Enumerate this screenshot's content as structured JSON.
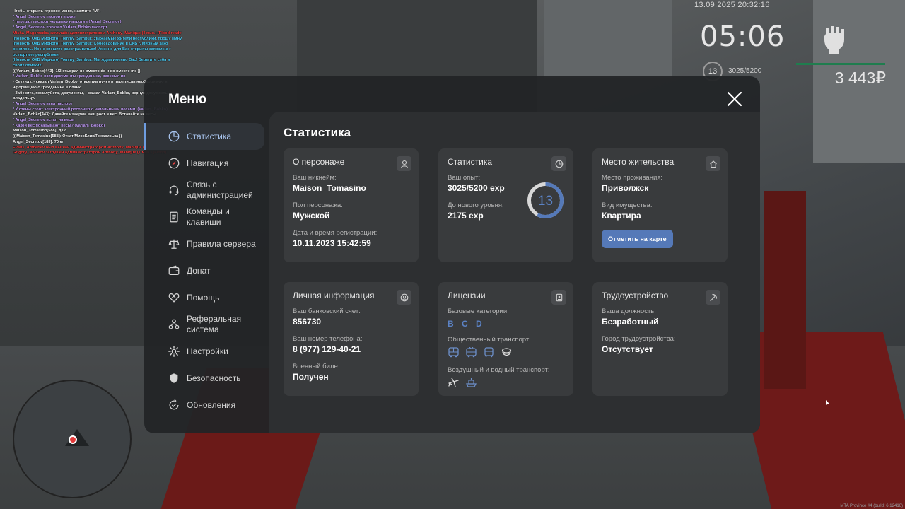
{
  "chat": [
    {
      "text": "Чтобы открыть игровое меню, нажмите \"M\".",
      "color": "w"
    },
    {
      "text": "* Angel_Secretov паспорт в руке",
      "color": "p"
    },
    {
      "text": "* передал паспорт человеку напротив (Angel_Secretov)",
      "color": "p"
    },
    {
      "text": "* Angel_Secretov показал Varlam_Bobko паспорт",
      "color": "p"
    },
    {
      "text": "Misha_Magomedov заглушён администратором Anthony_Manique (3 мин.) (Flood ready by AMM)",
      "color": "r"
    },
    {
      "text": "[Новости ОКБ Мирного] Tommy_Sambur: Уважаемые жители республики, прошу минуточку внимания!",
      "color": "c"
    },
    {
      "text": "[Новости ОКБ Мирного] Tommy_Sambur: Собеседование в ОКБ г. Мирный зако",
      "color": "c"
    },
    {
      "text": "ончилось. Но не спешите расстраиваться! Именно для Вас открыты заявки на г",
      "color": "c"
    },
    {
      "text": "ос.портале республики.",
      "color": "c"
    },
    {
      "text": "[Новости ОКБ Мирного] Tommy_Sambur: Мы ждем именно Вас! Берегите себя и",
      "color": "c"
    },
    {
      "text": "своих близких!",
      "color": "c"
    },
    {
      "text": "(( Varlam_Bobko[443]: 1!3 отыграл не вместо do и do вместе me ))",
      "color": "w"
    },
    {
      "text": "* Varlam_Bobko взяв документы гражданина, раскрыл их",
      "color": "p"
    },
    {
      "text": "- Секунду, - сказал Varlam_Bobko, открепив ручку и переписав необходимую и",
      "color": "w"
    },
    {
      "text": "нформацию о гражданине в бланк.",
      "color": "w"
    },
    {
      "text": "- Заберите, пожалуйста, документы, - сказал Varlam_Bobko, вернув документы",
      "color": "w"
    },
    {
      "text": "владельцу.",
      "color": "w"
    },
    {
      "text": "* Angel_Secretov взял паспорт",
      "color": "p"
    },
    {
      "text": "* У стены стоит электронный ростомер с напольными весами. (Varlam_Bobko)",
      "color": "p"
    },
    {
      "text": "Varlam_Bobko[443]: Давайте измерим ваш рост и вес. Вставайте на весы.",
      "color": "w"
    },
    {
      "text": "* Angel_Secretov встал на весы",
      "color": "p"
    },
    {
      "text": "* Какой вес показывают весы? (Varlam_Bobko)",
      "color": "p"
    },
    {
      "text": "Maison_Tomasino[588]: дшс",
      "color": "w"
    },
    {
      "text": "(( Maison_Tomasino[588]: Откат/МиссКлик/Томасиська ))",
      "color": "w"
    },
    {
      "text": "Angel_Secretov[183]: 70 кг",
      "color": "w"
    },
    {
      "text": "Evans_Amberlev был выгнан администратором Anthony_Manique (1 час.) (flood)",
      "color": "r"
    },
    {
      "text": "Grigory_Novikov заглушён администратором Anthony_Manique (7 мин.) (Flood)",
      "color": "r"
    }
  ],
  "hud": {
    "datetime": "13.09.2025 20:32:16",
    "clock": "05:06",
    "level": "13",
    "exp": "3025/5200",
    "money": "3 443₽",
    "watermark": "MTA Province #4 (build: 6.12416)"
  },
  "menu": {
    "title": "Меню",
    "nav": [
      {
        "label": "Статистика",
        "icon": "pie-chart-icon",
        "active": true
      },
      {
        "label": "Навигация",
        "icon": "compass-icon",
        "active": false
      },
      {
        "label": "Связь с администрацией",
        "icon": "headset-icon",
        "active": false
      },
      {
        "label": "Команды и клавиши",
        "icon": "document-icon",
        "active": false
      },
      {
        "label": "Правила сервера",
        "icon": "scales-icon",
        "active": false
      },
      {
        "label": "Донат",
        "icon": "wallet-icon",
        "active": false
      },
      {
        "label": "Помощь",
        "icon": "heart-handshake-icon",
        "active": false
      },
      {
        "label": "Реферальная система",
        "icon": "referral-icon",
        "active": false
      },
      {
        "label": "Настройки",
        "icon": "gear-icon",
        "active": false
      },
      {
        "label": "Безопасность",
        "icon": "shield-icon",
        "active": false
      },
      {
        "label": "Обновления",
        "icon": "refresh-check-icon",
        "active": false
      }
    ],
    "content_title": "Статистика",
    "cards": {
      "character": {
        "title": "О персонаже",
        "nickname_label": "Ваш никнейм:",
        "nickname": "Maison_Tomasino",
        "gender_label": "Пол персонажа:",
        "gender": "Мужской",
        "reg_label": "Дата и время регистрации:",
        "reg": "10.11.2023 15:42:59"
      },
      "stats": {
        "title": "Статистика",
        "exp_label": "Ваш опыт:",
        "exp": "3025/5200 exp",
        "next_label": "До нового уровня:",
        "next": "2175 exp",
        "level": "13",
        "progress": 0.58
      },
      "residence": {
        "title": "Место жительства",
        "place_label": "Место проживания:",
        "place": "Приволжск",
        "property_label": "Вид имущества:",
        "property": "Квартира",
        "map_button": "Отметить на карте"
      },
      "personal": {
        "title": "Личная информация",
        "bank_label": "Ваш банковский счет:",
        "bank": "856730",
        "phone_label": "Ваш номер телефона:",
        "phone": "8 (977) 129-40-21",
        "military_label": "Военный билет:",
        "military": "Получен"
      },
      "licenses": {
        "title": "Лицензии",
        "base_label": "Базовые категории:",
        "base": "B C D",
        "public_label": "Общественный транспорт:",
        "air_label": "Воздушный и водный транспорт:"
      },
      "job": {
        "title": "Трудоустройство",
        "position_label": "Ваша должность:",
        "position": "Безработный",
        "city_label": "Город трудоустройства:",
        "city": "Отсутствует"
      }
    }
  },
  "colors": {
    "accent": "#5579b8",
    "accent_light": "#6e9de0",
    "panel": "#222426",
    "card": "#393b3d"
  }
}
